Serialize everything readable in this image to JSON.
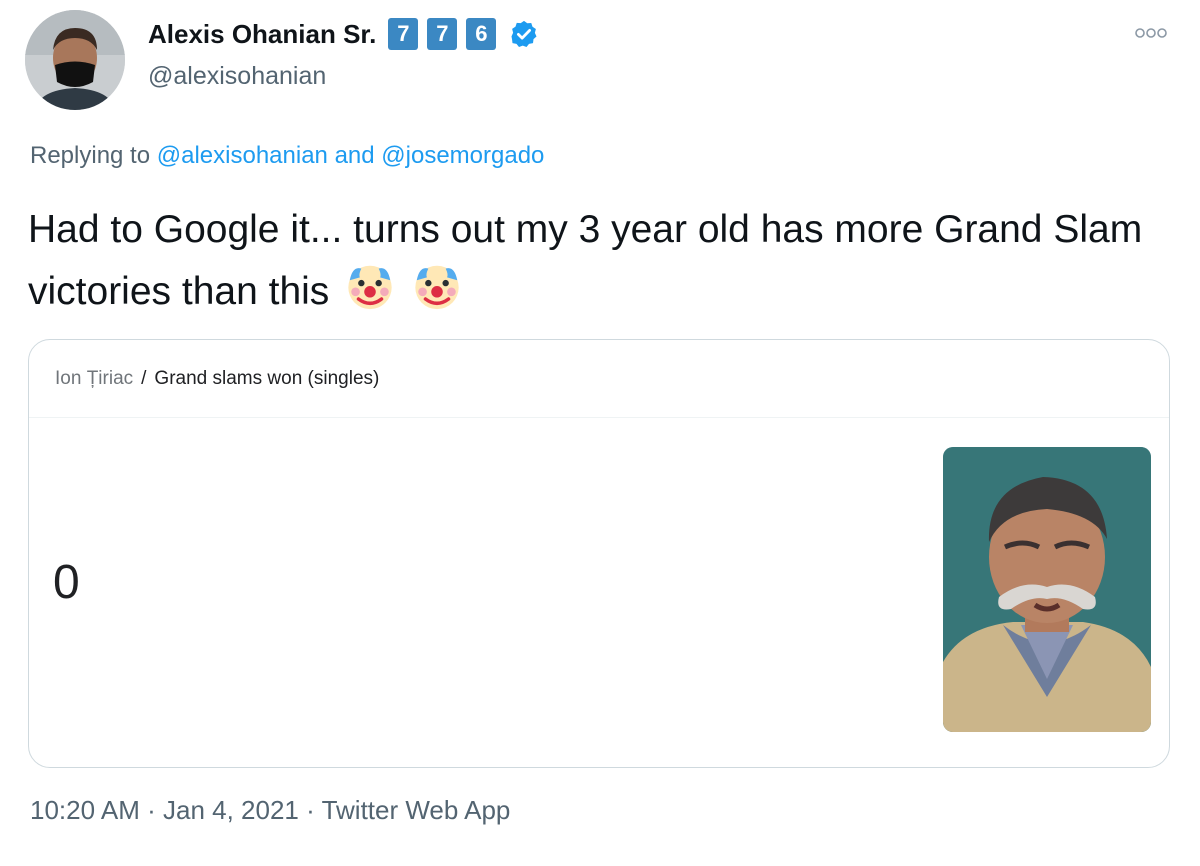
{
  "author": {
    "name": "Alexis Ohanian Sr.",
    "keycaps": [
      "7",
      "7",
      "6"
    ],
    "handle": "@alexisohanian",
    "verified": true
  },
  "reply": {
    "prefix": "Replying to",
    "mention1": "@alexisohanian",
    "conjunction": "and",
    "mention2": "@josemorgado"
  },
  "tweet": {
    "text": "Had to Google it... turns out my 3 year old has more Grand Slam victories than this",
    "emoji": [
      "clown-face",
      "clown-face"
    ]
  },
  "card": {
    "breadcrumb_entity": "Ion Țiriac",
    "breadcrumb_separator": "/",
    "breadcrumb_attribute": "Grand slams won (singles)",
    "value": "0"
  },
  "footer": {
    "time": "10:20 AM",
    "dot1": "·",
    "date": "Jan 4, 2021",
    "dot2": "·",
    "client": "Twitter Web App"
  },
  "colors": {
    "link": "#1d9bf0",
    "secondary_text": "#536471",
    "keycap": "#3b88c3",
    "verified": "#1d9bf0"
  }
}
